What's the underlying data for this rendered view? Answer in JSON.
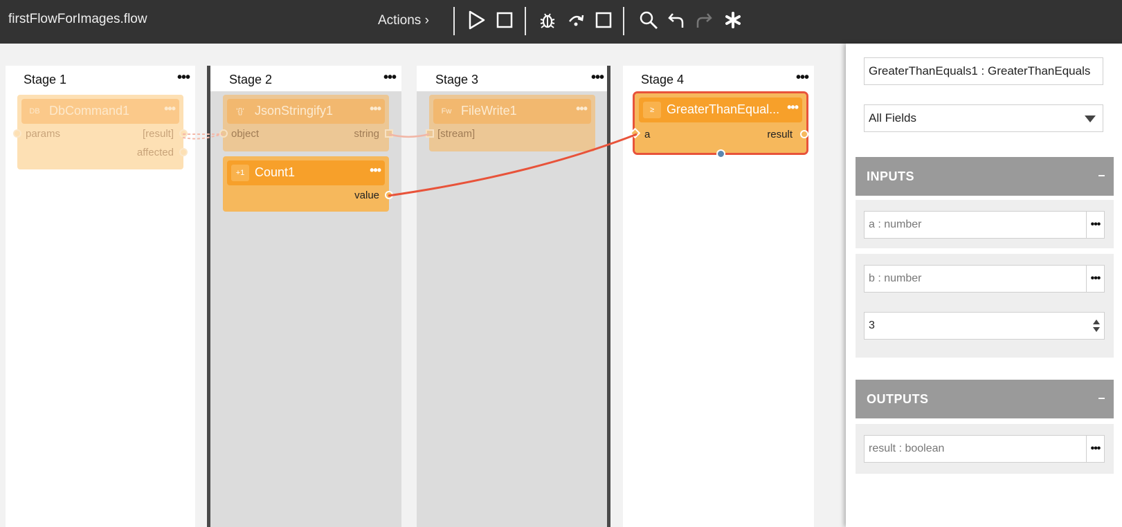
{
  "toolbar": {
    "file_name": "firstFlowForImages.flow",
    "actions_label": "Actions ›",
    "icons": [
      "play-icon",
      "stop-icon",
      "debug-bug-icon",
      "step-over-icon",
      "debug-stop-icon",
      "search-icon",
      "undo-icon",
      "redo-icon",
      "asterisk-icon"
    ]
  },
  "stages": [
    {
      "title": "Stage 1",
      "menu": "•••"
    },
    {
      "title": "Stage 2",
      "menu": "•••"
    },
    {
      "title": "Stage 3",
      "menu": "•••"
    },
    {
      "title": "Stage 4",
      "menu": "•••"
    }
  ],
  "nodes": {
    "db": {
      "icon": "DB",
      "name": "DbCommand1",
      "menu": "•••",
      "in_port": "params",
      "out_port": "[result]",
      "out_port2": "affected"
    },
    "json": {
      "icon": "'{}'",
      "name": "JsonStringify1",
      "menu": "•••",
      "in_port": "object",
      "out_port": "string"
    },
    "write": {
      "icon": "Fw",
      "name": "FileWrite1",
      "menu": "•••",
      "in_port": "[stream]"
    },
    "count": {
      "icon": "+1",
      "name": "Count1",
      "menu": "•••",
      "out_port": "value"
    },
    "gte": {
      "icon": "≥",
      "name": "GreaterThanEqual...",
      "menu": "•••",
      "in_port": "a",
      "out_port": "result"
    }
  },
  "panel": {
    "node_title": "GreaterThanEquals1 : GreaterThanEquals",
    "filter_value": "All Fields",
    "inputs_label": "INPUTS",
    "outputs_label": "OUTPUTS",
    "collapse_symbol": "–",
    "more_symbol": "•••",
    "inputs": [
      {
        "label": "a : number"
      },
      {
        "label": "b : number",
        "value": "3"
      }
    ],
    "outputs": [
      {
        "label": "result : boolean"
      }
    ]
  },
  "colors": {
    "toolbar": "#333333",
    "node_active": "#f7a02a",
    "selection": "#e8533a",
    "wire": "#e8533a"
  }
}
